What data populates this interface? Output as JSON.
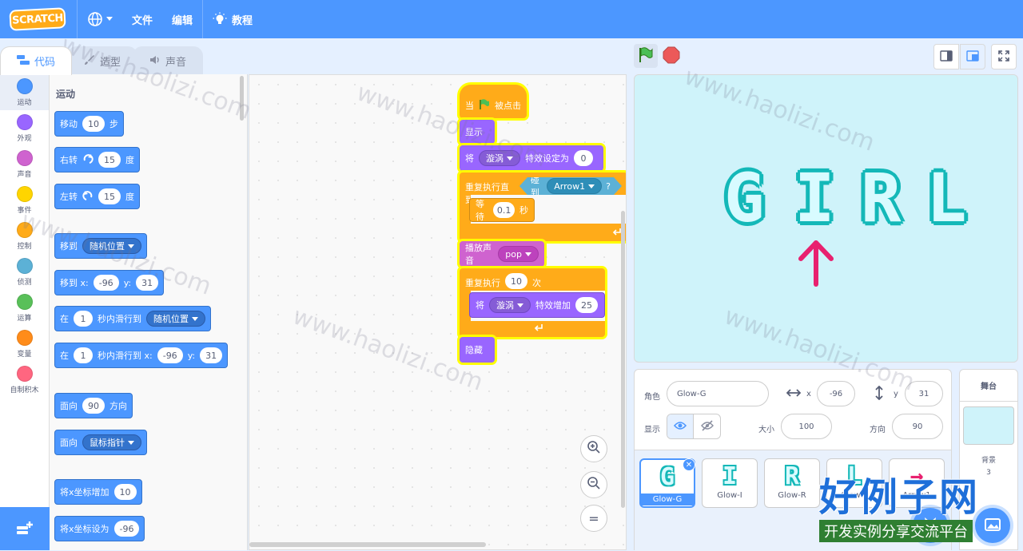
{
  "menubar": {
    "logo": "SCRATCH",
    "file": "文件",
    "edit": "编辑",
    "tutorial": "教程"
  },
  "tabs": {
    "code": "代码",
    "costumes": "造型",
    "sounds": "声音"
  },
  "categories": [
    {
      "label": "运动",
      "color": "#4c97ff"
    },
    {
      "label": "外观",
      "color": "#9966ff"
    },
    {
      "label": "声音",
      "color": "#cf63cf"
    },
    {
      "label": "事件",
      "color": "#ffd500"
    },
    {
      "label": "控制",
      "color": "#ffab19"
    },
    {
      "label": "侦测",
      "color": "#5cb1d6"
    },
    {
      "label": "运算",
      "color": "#59c059"
    },
    {
      "label": "变量",
      "color": "#ff8c1a"
    },
    {
      "label": "自制积木",
      "color": "#ff6680"
    }
  ],
  "palette": {
    "title": "运动",
    "move": {
      "a": "移动",
      "v": "10",
      "b": "步"
    },
    "turn_right": {
      "a": "右转",
      "v": "15",
      "b": "度"
    },
    "turn_left": {
      "a": "左转",
      "v": "15",
      "b": "度"
    },
    "goto": {
      "a": "移到",
      "drop": "随机位置"
    },
    "goto_xy": {
      "a": "移到 x:",
      "x": "-96",
      "yl": "y:",
      "y": "31"
    },
    "glide": {
      "a": "在",
      "v": "1",
      "b": "秒内滑行到",
      "drop": "随机位置"
    },
    "glide_xy": {
      "a": "在",
      "v": "1",
      "b": "秒内滑行到 x:",
      "x": "-96",
      "yl": "y:",
      "y": "31"
    },
    "point_dir": {
      "a": "面向",
      "v": "90",
      "b": "方向"
    },
    "point_towards": {
      "a": "面向",
      "drop": "鼠标指针"
    },
    "change_x": {
      "a": "将x坐标增加",
      "v": "10"
    },
    "set_x": {
      "a": "将x坐标设为",
      "v": "-96"
    }
  },
  "script": {
    "when_flag": {
      "a": "当",
      "b": "被点击"
    },
    "show": "显示",
    "set_effect": {
      "a": "将",
      "drop": "漩涡",
      "b": "特效设定为",
      "v": "0"
    },
    "repeat_until": {
      "a": "重复执行直到",
      "touch": "碰到",
      "drop": "Arrow1",
      "q": "?"
    },
    "wait": {
      "a": "等待",
      "v": "0.1",
      "b": "秒"
    },
    "play_sound": {
      "a": "播放声音",
      "drop": "pop"
    },
    "repeat": {
      "a": "重复执行",
      "v": "10",
      "b": "次"
    },
    "change_effect": {
      "a": "将",
      "drop": "漩涡",
      "b": "特效增加",
      "v": "25"
    },
    "hide": "隐藏",
    "zoom_reset": "="
  },
  "stage_text": [
    "G",
    "I",
    "R",
    "L"
  ],
  "sprite_info": {
    "sprite_label": "角色",
    "sprite_name": "Glow-G",
    "x_label": "x",
    "x": "-96",
    "y_label": "y",
    "y": "31",
    "show_label": "显示",
    "size_label": "大小",
    "size": "100",
    "dir_label": "方向",
    "dir": "90"
  },
  "sprites": [
    {
      "glyph": "G",
      "name": "Glow-G",
      "selected": true
    },
    {
      "glyph": "I",
      "name": "Glow-I"
    },
    {
      "glyph": "R",
      "name": "Glow-R"
    },
    {
      "glyph": "L",
      "name": "Glow-L"
    },
    {
      "glyph": "→",
      "name": "Arrow1"
    }
  ],
  "stage_panel": {
    "title": "舞台",
    "backdrops_label": "背景",
    "backdrops_count": "3"
  },
  "watermark": {
    "site": "www.haolizi.com",
    "brand": "好例子网",
    "brand_sub": "开发实例分享交流平台"
  }
}
